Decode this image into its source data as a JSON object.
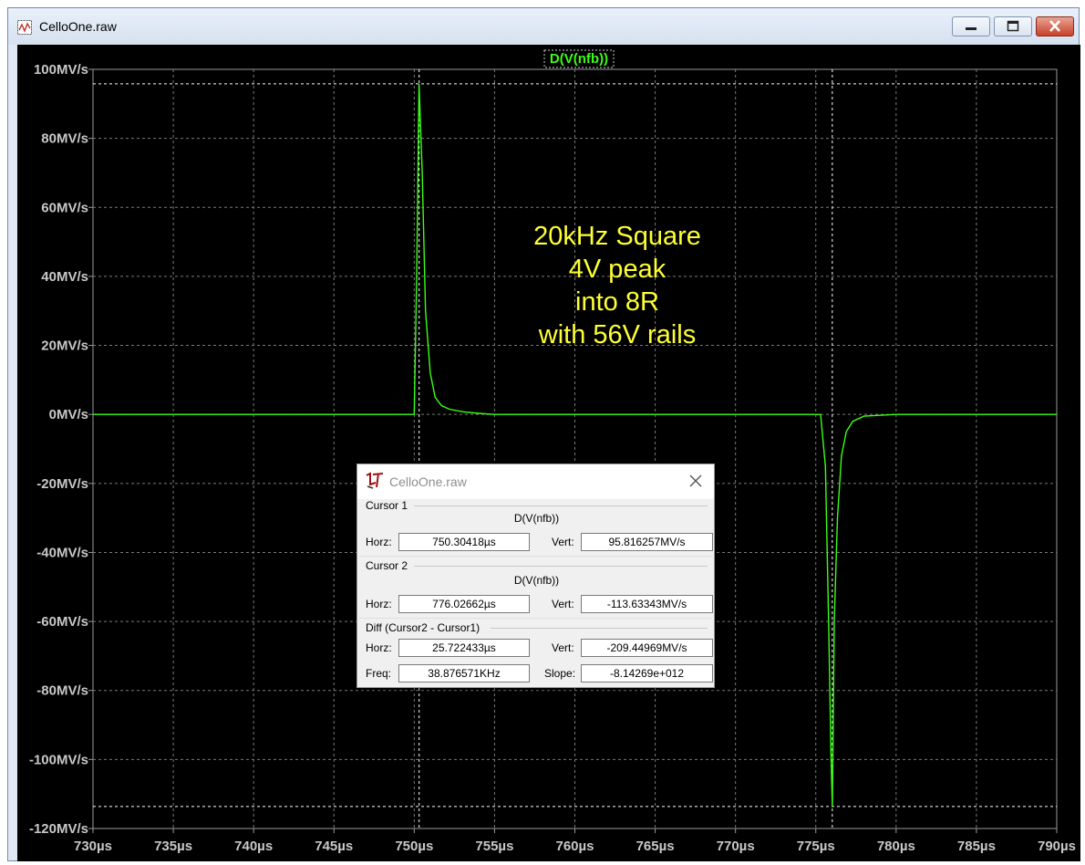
{
  "window": {
    "title": "CelloOne.raw",
    "minimize_icon": "minimize-icon",
    "maximize_icon": "maximize-icon",
    "close_icon": "close-icon"
  },
  "plot": {
    "trace_label": "D(V(nfb))",
    "trace_color": "#39ff14",
    "annotation": [
      "20kHz Square",
      "4V peak",
      "into 8R",
      "with 56V rails"
    ],
    "annotation_color": "#ffff33",
    "y_ticks": [
      "100MV/s",
      "80MV/s",
      "60MV/s",
      "40MV/s",
      "20MV/s",
      "0MV/s",
      "-20MV/s",
      "-40MV/s",
      "-60MV/s",
      "-80MV/s",
      "-100MV/s",
      "-120MV/s"
    ],
    "x_ticks": [
      "730µs",
      "735µs",
      "740µs",
      "745µs",
      "750µs",
      "755µs",
      "760µs",
      "765µs",
      "770µs",
      "775µs",
      "780µs",
      "785µs",
      "790µs"
    ]
  },
  "chart_data": {
    "type": "line",
    "title": "",
    "xlabel": "",
    "ylabel": "",
    "xlim": [
      730,
      790
    ],
    "ylim": [
      -120,
      100
    ],
    "grid": true,
    "series": [
      {
        "name": "D(V(nfb))",
        "color": "#39ff14",
        "x": [
          730,
          750.0,
          750.15,
          750.3,
          750.5,
          750.7,
          751.0,
          751.3,
          751.7,
          752.2,
          753,
          754,
          755,
          760,
          770,
          775.3,
          775.6,
          775.8,
          775.95,
          776.03,
          776.15,
          776.35,
          776.6,
          776.9,
          777.3,
          778,
          780,
          790
        ],
        "y": [
          0,
          0,
          40,
          95.8,
          70,
          30,
          12,
          5,
          2.5,
          1.5,
          0.8,
          0.3,
          0,
          0,
          0,
          0,
          -15,
          -60,
          -100,
          -113.6,
          -60,
          -30,
          -12,
          -5,
          -2,
          -0.5,
          0,
          0
        ]
      }
    ],
    "cursors": [
      {
        "x": 750.30418,
        "y": 95.816257
      },
      {
        "x": 776.02662,
        "y": -113.63343
      }
    ]
  },
  "cursor_dialog": {
    "title": "CelloOne.raw",
    "logo_icon": "ltspice-logo-icon",
    "close_icon": "close-icon",
    "cursor1": {
      "label": "Cursor 1",
      "signal": "D(V(nfb))",
      "horz_label": "Horz:",
      "horz": "750.30418µs",
      "vert_label": "Vert:",
      "vert": "95.816257MV/s"
    },
    "cursor2": {
      "label": "Cursor 2",
      "signal": "D(V(nfb))",
      "horz_label": "Horz:",
      "horz": "776.02662µs",
      "vert_label": "Vert:",
      "vert": "-113.63343MV/s"
    },
    "diff": {
      "label": "Diff (Cursor2 - Cursor1)",
      "horz_label": "Horz:",
      "horz": "25.722433µs",
      "vert_label": "Vert:",
      "vert": "-209.44969MV/s",
      "freq_label": "Freq:",
      "freq": "38.876571KHz",
      "slope_label": "Slope:",
      "slope": "-8.14269e+012"
    }
  }
}
